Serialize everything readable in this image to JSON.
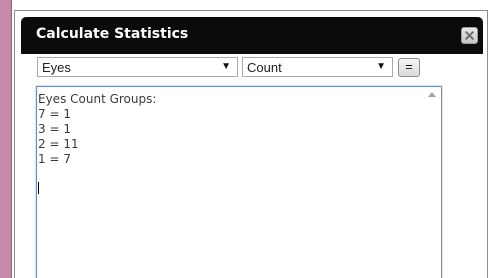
{
  "dialog": {
    "title": "Calculate Statistics",
    "close_icon": "close-x-icon"
  },
  "controls": {
    "field_select": {
      "value": "Eyes",
      "arrow_icon": "dropdown-arrow-icon"
    },
    "stat_select": {
      "value": "Count",
      "arrow_icon": "dropdown-arrow-icon"
    },
    "equals_label": "="
  },
  "results": {
    "text": "Eyes Count Groups:\n7 = 1\n3 = 1\n2 = 11\n1 = 7",
    "lines": [
      "Eyes Count Groups:",
      "7 = 1",
      "3 = 1",
      "2 = 11",
      "1 = 7"
    ],
    "scroll_up_icon": "scroll-up-arrow-icon"
  },
  "colors": {
    "left_strip": "#c68aa9",
    "titlebar": "#0b0b0b",
    "title_text": "#ffffff",
    "textarea_border": "#6f8fc4"
  }
}
